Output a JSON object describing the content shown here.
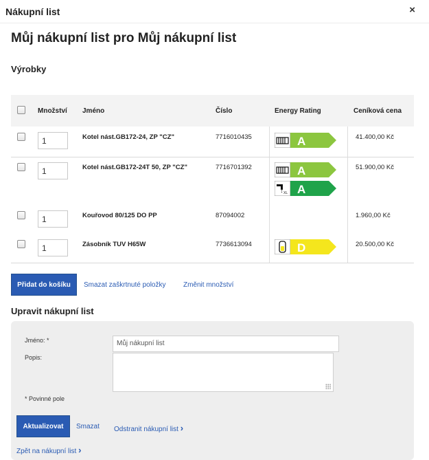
{
  "window": {
    "title": "Nákupní list",
    "close_glyph": "×"
  },
  "page_title": "Můj nákupní list pro Můj nákupní list",
  "products_section": "Výrobky",
  "table": {
    "headers": {
      "quantity": "Množství",
      "name": "Jméno",
      "number": "Číslo",
      "energy": "Energy Rating",
      "price": "Ceníková cena"
    },
    "rows": [
      {
        "qty": "1",
        "name": "Kotel nást.GB172-24, ZP \"CZ\"",
        "number": "7716010435",
        "price": "41.400,00 Kč",
        "ratings": [
          {
            "icon": "radiator-icon",
            "grade": "A",
            "color": "#8cc63f"
          }
        ]
      },
      {
        "qty": "1",
        "name": "Kotel nást.GB172-24T 50, ZP \"CZ\"",
        "number": "7716701392",
        "price": "51.900,00 Kč",
        "ratings": [
          {
            "icon": "radiator-icon",
            "grade": "A",
            "color": "#8cc63f"
          },
          {
            "icon": "tap-icon",
            "grade": "A",
            "color": "#1fa34a",
            "sub": "XL"
          }
        ]
      },
      {
        "qty": "1",
        "name": "Kouřovod 80/125 DO PP",
        "number": "87094002",
        "price": "1.960,00 Kč",
        "ratings": []
      },
      {
        "qty": "1",
        "name": "Zásobník TUV H65W",
        "number": "7736613094",
        "price": "20.500,00 Kč",
        "ratings": [
          {
            "icon": "tank-icon",
            "grade": "D",
            "color": "#f4e61d"
          }
        ]
      }
    ]
  },
  "actions": {
    "add_to_cart": "Přidat do košíku",
    "delete_checked": "Smazat zaškrtnuté položky",
    "change_quantity": "Změnit množství"
  },
  "edit_section": "Upravit nákupní list",
  "form": {
    "name_label": "Jméno: *",
    "name_value": "Můj nákupní list",
    "desc_label": "Popis:",
    "desc_value": "",
    "required_note": "* Povinné pole",
    "update_button": "Aktualizovat",
    "delete_link": "Smazat",
    "remove_link": "Odstranit nákupní list",
    "back_link": "Zpět na nákupní list",
    "chevron": "›"
  },
  "colors": {
    "accent": "#2a5bb3",
    "panel": "#eeeeee",
    "header_bg": "#f3f3f3"
  }
}
